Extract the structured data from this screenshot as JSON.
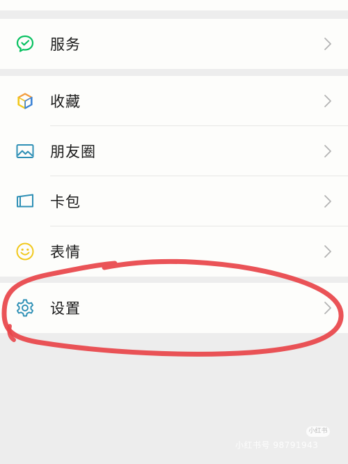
{
  "groups": [
    {
      "items": [
        {
          "label": "服务",
          "icon": "wechat-pay-icon"
        }
      ]
    },
    {
      "items": [
        {
          "label": "收藏",
          "icon": "cube-icon"
        },
        {
          "label": "朋友圈",
          "icon": "image-icon"
        },
        {
          "label": "卡包",
          "icon": "card-wallet-icon"
        },
        {
          "label": "表情",
          "icon": "smiley-icon"
        }
      ]
    },
    {
      "items": [
        {
          "label": "设置",
          "icon": "gear-icon"
        }
      ]
    }
  ],
  "watermark": {
    "badge": "小红书",
    "text": "小红书号 98791943"
  },
  "colors": {
    "background": "#ededed",
    "row_background": "#fdfdfb",
    "annotation_red": "#e8464a",
    "wechat_green": "#07c160",
    "teal": "#2d8fb5",
    "smiley_yellow": "#f1c81c"
  }
}
